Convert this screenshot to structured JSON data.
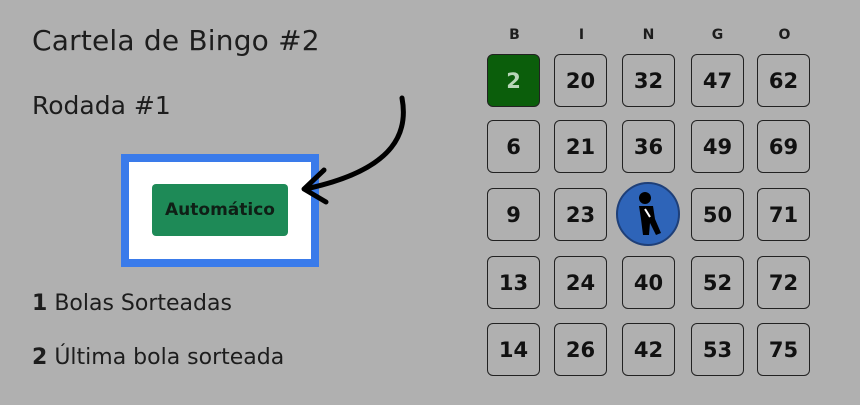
{
  "card": {
    "title": "Cartela de Bingo #2",
    "round": "Rodada #1"
  },
  "controls": {
    "auto_label": "Automático"
  },
  "stats": {
    "balls_drawn_count": "1",
    "balls_drawn_label": "Bolas Sorteadas",
    "last_ball_value": "2",
    "last_ball_label": "Última bola sorteada"
  },
  "grid": {
    "letters": [
      "B",
      "I",
      "N",
      "G",
      "O"
    ],
    "rows": [
      [
        "2",
        "20",
        "32",
        "47",
        "62"
      ],
      [
        "6",
        "21",
        "36",
        "49",
        "69"
      ],
      [
        "9",
        "23",
        "",
        "50",
        "71"
      ],
      [
        "13",
        "24",
        "40",
        "52",
        "72"
      ],
      [
        "14",
        "26",
        "42",
        "53",
        "75"
      ]
    ],
    "marked": [
      "2"
    ],
    "free_icon": "free-space-person-icon"
  },
  "colors": {
    "background": "#b0b0b0",
    "marked_cell": "#0b5e0b",
    "button": "#1e8a57",
    "highlight_frame": "#3a7bea",
    "free_space": "#2e64b8"
  }
}
